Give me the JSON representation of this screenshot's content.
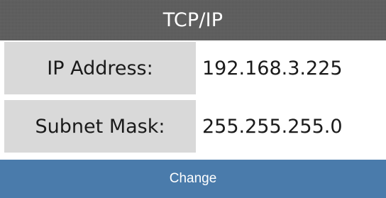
{
  "header": {
    "title": "TCP/IP"
  },
  "fields": {
    "ip_address": {
      "label": "IP Address:",
      "value": "192.168.3.225"
    },
    "subnet_mask": {
      "label": "Subnet Mask:",
      "value": "255.255.255.0"
    }
  },
  "actions": {
    "change_label": "Change"
  },
  "colors": {
    "header_bg": "#5b5b5b",
    "label_bg": "#d9d9d9",
    "button_bg": "#4a7bab"
  }
}
